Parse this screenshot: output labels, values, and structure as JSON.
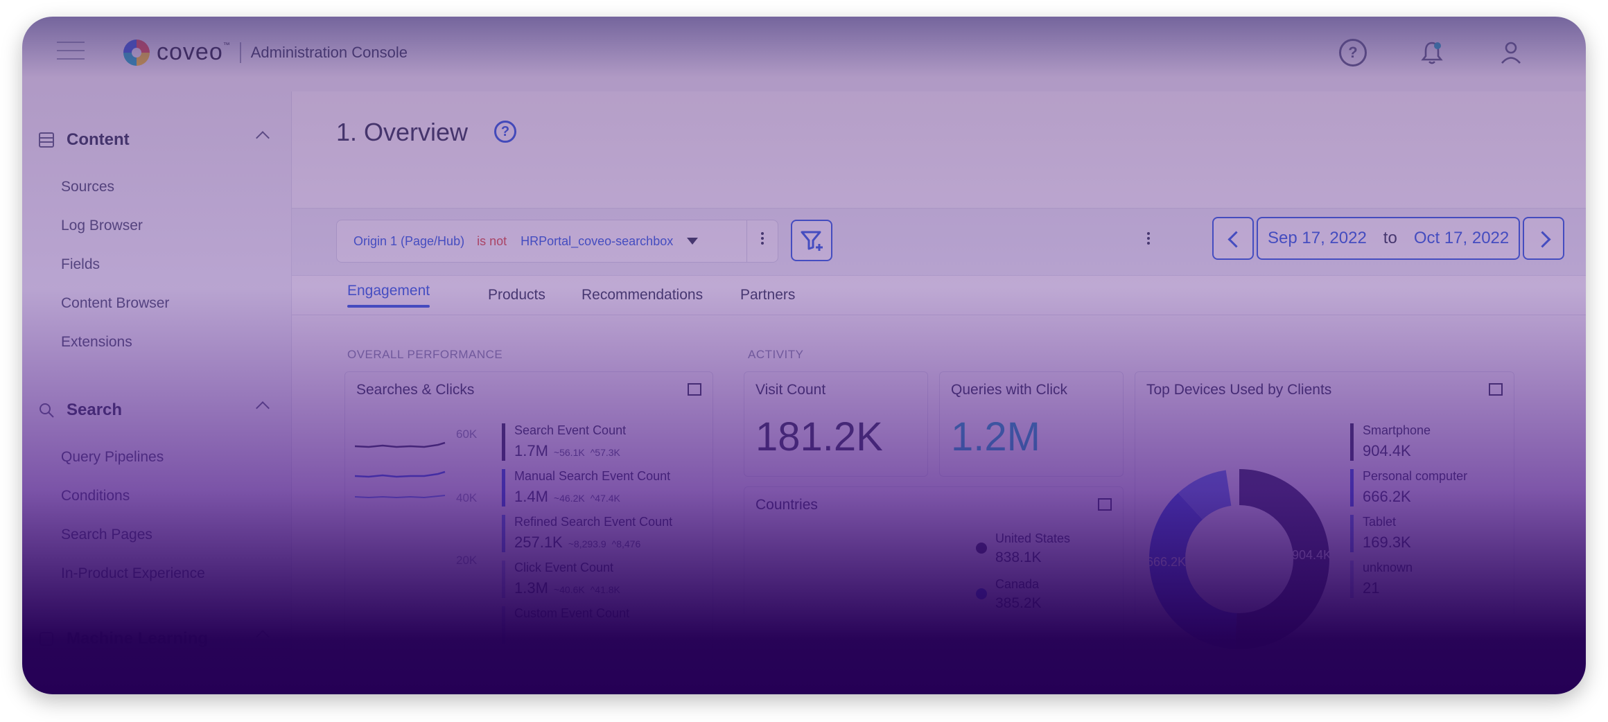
{
  "header": {
    "brand": "coveo",
    "brand_tm": "™",
    "subtitle": "Administration Console"
  },
  "sidebar": {
    "sections": [
      {
        "title": "Content",
        "items": [
          "Sources",
          "Log Browser",
          "Fields",
          "Content Browser",
          "Extensions"
        ]
      },
      {
        "title": "Search",
        "items": [
          "Query Pipelines",
          "Conditions",
          "Search Pages",
          "In-Product Experience"
        ]
      },
      {
        "title": "Machine Learning"
      }
    ]
  },
  "page": {
    "title": "1. Overview"
  },
  "filter": {
    "key": "Origin 1 (Page/Hub)",
    "operator": "is not",
    "value": "HRPortal_coveo-searchbox"
  },
  "date_range": {
    "from": "Sep 17, 2022",
    "to_label": "to",
    "to": "Oct 17, 2022"
  },
  "tabs": [
    "Engagement",
    "Products",
    "Recommendations",
    "Partners"
  ],
  "sections": {
    "overall": "OVERALL PERFORMANCE",
    "activity": "ACTIVITY"
  },
  "searches_clicks": {
    "title": "Searches & Clicks",
    "y_ticks": [
      "60K",
      "40K",
      "20K"
    ],
    "legend": [
      {
        "name": "Search Event Count",
        "value": "1.7M",
        "min": "56.1K",
        "max": "57.3K"
      },
      {
        "name": "Manual Search Event Count",
        "value": "1.4M",
        "min": "46.2K",
        "max": "47.4K"
      },
      {
        "name": "Refined Search Event Count",
        "value": "257.1K",
        "min": "8,293.9",
        "max": "8,476"
      },
      {
        "name": "Click Event Count",
        "value": "1.3M",
        "min": "40.6K",
        "max": "41.8K"
      },
      {
        "name": "Custom Event Count"
      }
    ]
  },
  "visit_count": {
    "title": "Visit Count",
    "value": "181.2K"
  },
  "queries_click": {
    "title": "Queries with Click",
    "value": "1.2M"
  },
  "countries": {
    "title": "Countries",
    "items": [
      {
        "name": "United States",
        "value": "838.1K"
      },
      {
        "name": "Canada",
        "value": "385.2K"
      }
    ]
  },
  "devices": {
    "title": "Top Devices Used by Clients",
    "donut_labels": {
      "left": "666.2K",
      "right": "904.4K"
    },
    "items": [
      {
        "name": "Smartphone",
        "value": "904.4K"
      },
      {
        "name": "Personal computer",
        "value": "666.2K"
      },
      {
        "name": "Tablet",
        "value": "169.3K"
      },
      {
        "name": "unknown",
        "value": "21"
      }
    ]
  },
  "colors": {
    "accent": "#2f62e2",
    "negative": "#e05244",
    "text": "#323c56",
    "overlay_bottom": "#250055"
  }
}
